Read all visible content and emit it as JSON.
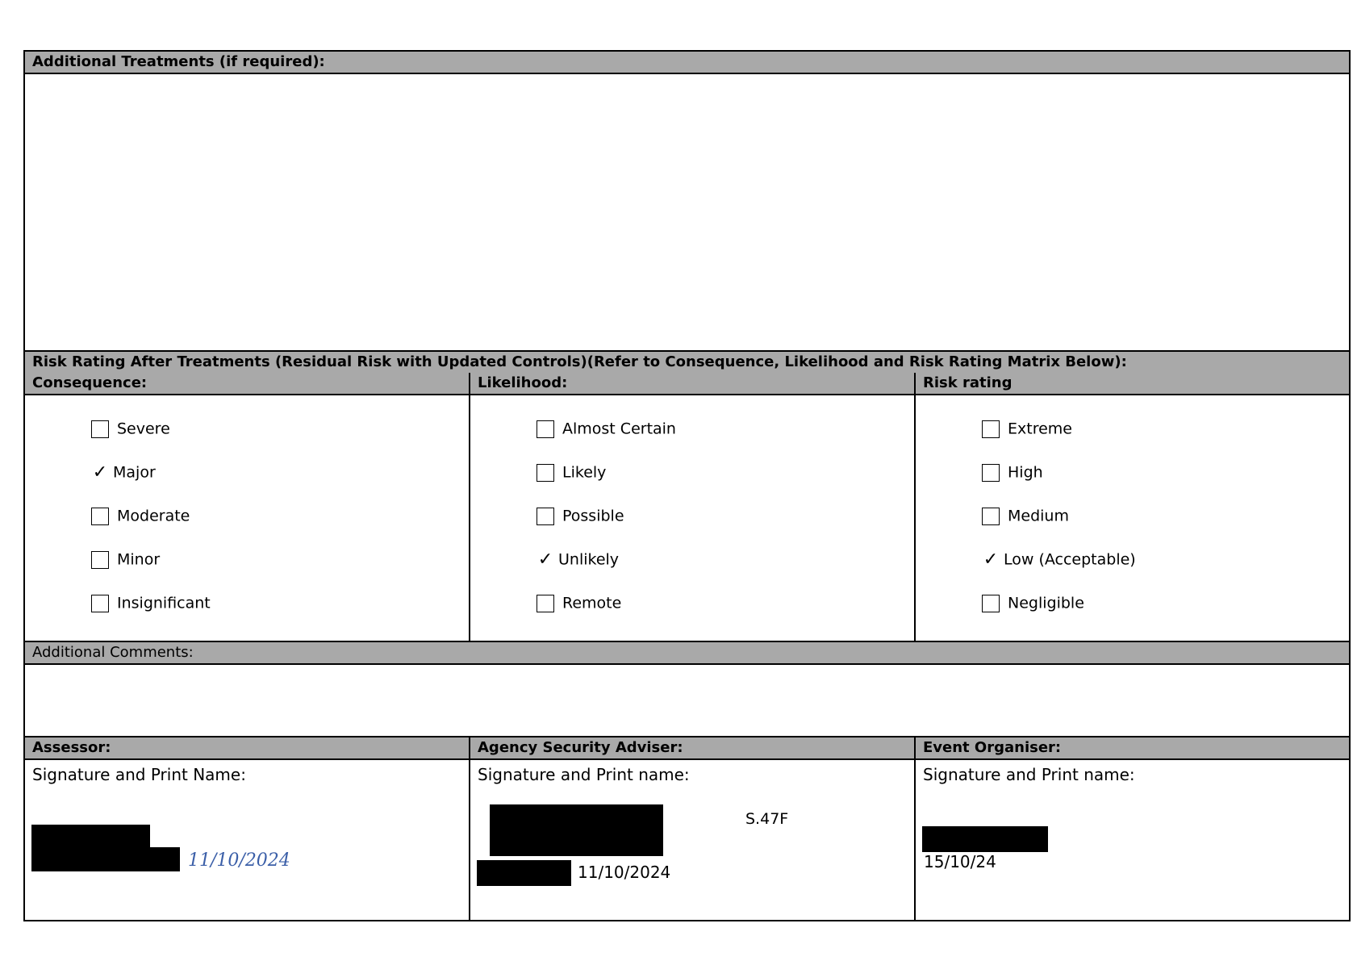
{
  "additional_treatments": {
    "header": "Additional Treatments (if required):",
    "value": ""
  },
  "residual_risk": {
    "header": "Risk Rating After Treatments (Residual Risk with Updated Controls)(Refer to Consequence, Likelihood and Risk Rating Matrix Below):",
    "consequence": {
      "header": "Consequence:",
      "options": [
        {
          "label": "Severe",
          "checked": false
        },
        {
          "label": "Major",
          "checked": true
        },
        {
          "label": "Moderate",
          "checked": false
        },
        {
          "label": "Minor",
          "checked": false
        },
        {
          "label": "Insignificant",
          "checked": false
        }
      ]
    },
    "likelihood": {
      "header": "Likelihood:",
      "options": [
        {
          "label": "Almost Certain",
          "checked": false
        },
        {
          "label": "Likely",
          "checked": false
        },
        {
          "label": "Possible",
          "checked": false
        },
        {
          "label": "Unlikely",
          "checked": true
        },
        {
          "label": "Remote",
          "checked": false
        }
      ]
    },
    "risk_rating": {
      "header": "Risk rating",
      "options": [
        {
          "label": "Extreme",
          "checked": false
        },
        {
          "label": "High",
          "checked": false
        },
        {
          "label": "Medium",
          "checked": false
        },
        {
          "label": "Low (Acceptable)",
          "checked": true
        },
        {
          "label": "Negligible",
          "checked": false
        }
      ]
    }
  },
  "additional_comments": {
    "header": "Additional Comments:",
    "value": ""
  },
  "signatures": {
    "assessor": {
      "header": "Assessor:",
      "label": "Signature and Print Name:",
      "date": "11/10/2024"
    },
    "security_adviser": {
      "header": "Agency Security Adviser:",
      "label": "Signature and Print name:",
      "date": "11/10/2024",
      "exemption": "S.47F"
    },
    "event_organiser": {
      "header": "Event Organiser:",
      "label": "Signature and Print name:",
      "date": "15/10/24"
    }
  },
  "icons": {
    "checked": "checkmark-icon",
    "unchecked": "empty-checkbox"
  }
}
